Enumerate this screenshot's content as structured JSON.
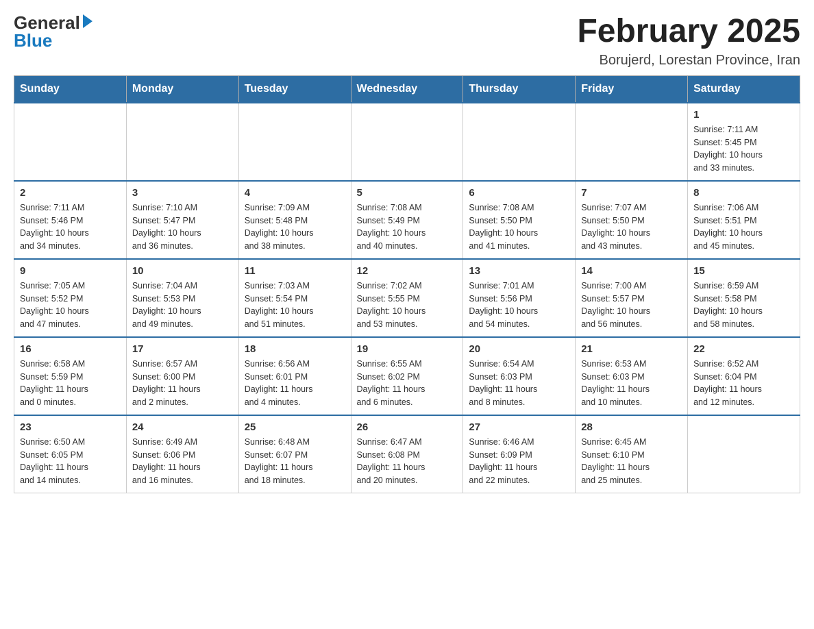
{
  "header": {
    "logo_general": "General",
    "logo_blue": "Blue",
    "month_title": "February 2025",
    "location": "Borujerd, Lorestan Province, Iran"
  },
  "weekdays": [
    "Sunday",
    "Monday",
    "Tuesday",
    "Wednesday",
    "Thursday",
    "Friday",
    "Saturday"
  ],
  "weeks": [
    [
      {
        "day": "",
        "info": ""
      },
      {
        "day": "",
        "info": ""
      },
      {
        "day": "",
        "info": ""
      },
      {
        "day": "",
        "info": ""
      },
      {
        "day": "",
        "info": ""
      },
      {
        "day": "",
        "info": ""
      },
      {
        "day": "1",
        "info": "Sunrise: 7:11 AM\nSunset: 5:45 PM\nDaylight: 10 hours\nand 33 minutes."
      }
    ],
    [
      {
        "day": "2",
        "info": "Sunrise: 7:11 AM\nSunset: 5:46 PM\nDaylight: 10 hours\nand 34 minutes."
      },
      {
        "day": "3",
        "info": "Sunrise: 7:10 AM\nSunset: 5:47 PM\nDaylight: 10 hours\nand 36 minutes."
      },
      {
        "day": "4",
        "info": "Sunrise: 7:09 AM\nSunset: 5:48 PM\nDaylight: 10 hours\nand 38 minutes."
      },
      {
        "day": "5",
        "info": "Sunrise: 7:08 AM\nSunset: 5:49 PM\nDaylight: 10 hours\nand 40 minutes."
      },
      {
        "day": "6",
        "info": "Sunrise: 7:08 AM\nSunset: 5:50 PM\nDaylight: 10 hours\nand 41 minutes."
      },
      {
        "day": "7",
        "info": "Sunrise: 7:07 AM\nSunset: 5:50 PM\nDaylight: 10 hours\nand 43 minutes."
      },
      {
        "day": "8",
        "info": "Sunrise: 7:06 AM\nSunset: 5:51 PM\nDaylight: 10 hours\nand 45 minutes."
      }
    ],
    [
      {
        "day": "9",
        "info": "Sunrise: 7:05 AM\nSunset: 5:52 PM\nDaylight: 10 hours\nand 47 minutes."
      },
      {
        "day": "10",
        "info": "Sunrise: 7:04 AM\nSunset: 5:53 PM\nDaylight: 10 hours\nand 49 minutes."
      },
      {
        "day": "11",
        "info": "Sunrise: 7:03 AM\nSunset: 5:54 PM\nDaylight: 10 hours\nand 51 minutes."
      },
      {
        "day": "12",
        "info": "Sunrise: 7:02 AM\nSunset: 5:55 PM\nDaylight: 10 hours\nand 53 minutes."
      },
      {
        "day": "13",
        "info": "Sunrise: 7:01 AM\nSunset: 5:56 PM\nDaylight: 10 hours\nand 54 minutes."
      },
      {
        "day": "14",
        "info": "Sunrise: 7:00 AM\nSunset: 5:57 PM\nDaylight: 10 hours\nand 56 minutes."
      },
      {
        "day": "15",
        "info": "Sunrise: 6:59 AM\nSunset: 5:58 PM\nDaylight: 10 hours\nand 58 minutes."
      }
    ],
    [
      {
        "day": "16",
        "info": "Sunrise: 6:58 AM\nSunset: 5:59 PM\nDaylight: 11 hours\nand 0 minutes."
      },
      {
        "day": "17",
        "info": "Sunrise: 6:57 AM\nSunset: 6:00 PM\nDaylight: 11 hours\nand 2 minutes."
      },
      {
        "day": "18",
        "info": "Sunrise: 6:56 AM\nSunset: 6:01 PM\nDaylight: 11 hours\nand 4 minutes."
      },
      {
        "day": "19",
        "info": "Sunrise: 6:55 AM\nSunset: 6:02 PM\nDaylight: 11 hours\nand 6 minutes."
      },
      {
        "day": "20",
        "info": "Sunrise: 6:54 AM\nSunset: 6:03 PM\nDaylight: 11 hours\nand 8 minutes."
      },
      {
        "day": "21",
        "info": "Sunrise: 6:53 AM\nSunset: 6:03 PM\nDaylight: 11 hours\nand 10 minutes."
      },
      {
        "day": "22",
        "info": "Sunrise: 6:52 AM\nSunset: 6:04 PM\nDaylight: 11 hours\nand 12 minutes."
      }
    ],
    [
      {
        "day": "23",
        "info": "Sunrise: 6:50 AM\nSunset: 6:05 PM\nDaylight: 11 hours\nand 14 minutes."
      },
      {
        "day": "24",
        "info": "Sunrise: 6:49 AM\nSunset: 6:06 PM\nDaylight: 11 hours\nand 16 minutes."
      },
      {
        "day": "25",
        "info": "Sunrise: 6:48 AM\nSunset: 6:07 PM\nDaylight: 11 hours\nand 18 minutes."
      },
      {
        "day": "26",
        "info": "Sunrise: 6:47 AM\nSunset: 6:08 PM\nDaylight: 11 hours\nand 20 minutes."
      },
      {
        "day": "27",
        "info": "Sunrise: 6:46 AM\nSunset: 6:09 PM\nDaylight: 11 hours\nand 22 minutes."
      },
      {
        "day": "28",
        "info": "Sunrise: 6:45 AM\nSunset: 6:10 PM\nDaylight: 11 hours\nand 25 minutes."
      },
      {
        "day": "",
        "info": ""
      }
    ]
  ]
}
